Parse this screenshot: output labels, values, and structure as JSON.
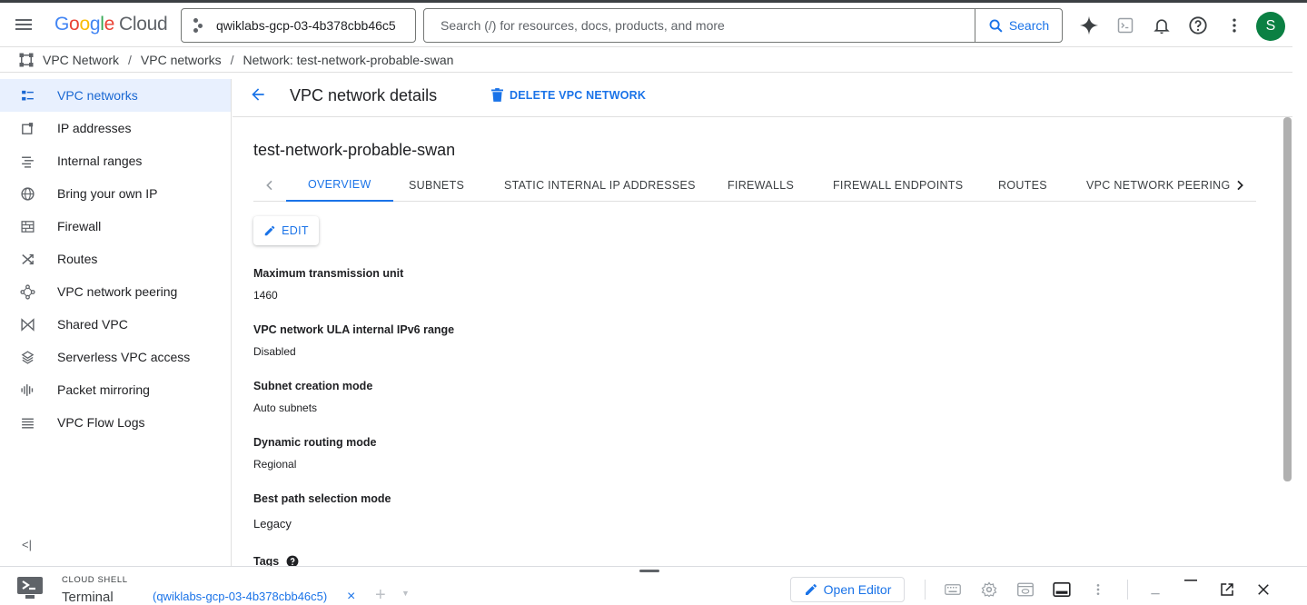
{
  "topbar": {
    "logo": {
      "g1": "G",
      "g2": "o",
      "g3": "o",
      "g1b": "g",
      "g4": "l",
      "g2b": "e",
      "cloud": "Cloud"
    },
    "project": "qwiklabs-gcp-03-4b378cbb46c5",
    "search_placeholder": "Search (/) for resources, docs, products, and more",
    "search_button": "Search",
    "avatar_letter": "S",
    "icons": [
      "menu-icon",
      "gemini-icon",
      "cloud-shell-icon",
      "notifications-icon",
      "help-icon",
      "more-vert-icon"
    ]
  },
  "breadcrumb": {
    "root": "VPC Network",
    "section": "VPC networks",
    "current_prefix": "Network:",
    "current_name": "test-network-probable-swan"
  },
  "sidebar": {
    "items": [
      {
        "label": "VPC networks",
        "icon": "vpc-networks-icon",
        "active": true
      },
      {
        "label": "IP addresses",
        "icon": "ip-addresses-icon"
      },
      {
        "label": "Internal ranges",
        "icon": "internal-ranges-icon"
      },
      {
        "label": "Bring your own IP",
        "icon": "globe-icon"
      },
      {
        "label": "Firewall",
        "icon": "firewall-icon"
      },
      {
        "label": "Routes",
        "icon": "routes-icon"
      },
      {
        "label": "VPC network peering",
        "icon": "peering-icon"
      },
      {
        "label": "Shared VPC",
        "icon": "shared-vpc-icon"
      },
      {
        "label": "Serverless VPC access",
        "icon": "serverless-icon"
      },
      {
        "label": "Packet mirroring",
        "icon": "packet-mirroring-icon"
      },
      {
        "label": "VPC Flow Logs",
        "icon": "flow-logs-icon"
      }
    ],
    "collapse_label": "<|"
  },
  "main": {
    "title": "VPC network details",
    "delete_label": "DELETE VPC NETWORK",
    "network_name": "test-network-probable-swan",
    "tabs": [
      {
        "label": "OVERVIEW",
        "active": true
      },
      {
        "label": "SUBNETS"
      },
      {
        "label": "STATIC INTERNAL IP ADDRESSES"
      },
      {
        "label": "FIREWALLS"
      },
      {
        "label": "FIREWALL ENDPOINTS"
      },
      {
        "label": "ROUTES"
      },
      {
        "label": "VPC NETWORK PEERING"
      }
    ],
    "edit_label": "EDIT",
    "properties": [
      {
        "label": "Maximum transmission unit",
        "value": "1460"
      },
      {
        "label": "VPC network ULA internal IPv6 range",
        "value": "Disabled"
      },
      {
        "label": "Subnet creation mode",
        "value": "Auto subnets"
      },
      {
        "label": "Dynamic routing mode",
        "value": "Regional"
      },
      {
        "label": "Best path selection mode",
        "value": "Legacy"
      },
      {
        "label": "Tags",
        "value": ""
      }
    ]
  },
  "cloud_shell": {
    "caption": "CLOUD SHELL",
    "title": "Terminal",
    "tab_label": "(qwiklabs-gcp-03-4b378cbb46c5)",
    "tab_close": "×",
    "add_tab": "+",
    "open_editor": "Open Editor"
  },
  "colors": {
    "accent": "#1a73e8",
    "active_bg": "#e8f0fe",
    "avatar": "#0b8043"
  }
}
